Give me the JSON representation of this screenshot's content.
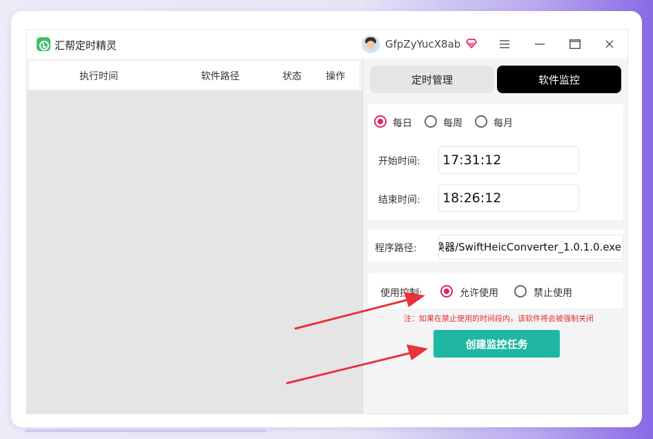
{
  "window": {
    "title": "汇帮定时精灵",
    "username": "GfpZyYucX8ab",
    "menu_icon": "hamburger-icon",
    "minimize_icon": "minimize-icon",
    "maximize_icon": "maximize-icon",
    "close_icon": "close-icon"
  },
  "table": {
    "columns": [
      "执行时间",
      "软件路径",
      "状态",
      "操作"
    ],
    "rows": []
  },
  "tabs": [
    {
      "label": "定时管理",
      "active": false
    },
    {
      "label": "软件监控",
      "active": true
    }
  ],
  "schedule": {
    "options": [
      "每日",
      "每周",
      "每月"
    ],
    "selected": "每日",
    "start_label": "开始时间:",
    "start_value": "17:31:12",
    "end_label": "结束时间:",
    "end_value": "18:26:12"
  },
  "program": {
    "label": "程序路径:",
    "value": "换器/SwiftHeicConverter_1.0.1.0.exe"
  },
  "control": {
    "label": "使用控制:",
    "options": [
      "允许使用",
      "禁止使用"
    ],
    "selected": "允许使用"
  },
  "note": "注：如果在禁止使用的时间段内，该软件将会被强制关闭",
  "create_button": "创建监控任务",
  "colors": {
    "accent_radio": "#e0245e",
    "create_button": "#1fb7a3",
    "annotation_arrow": "#e8323c",
    "tab_active_bg": "#000000",
    "note_text": "#e03030"
  }
}
